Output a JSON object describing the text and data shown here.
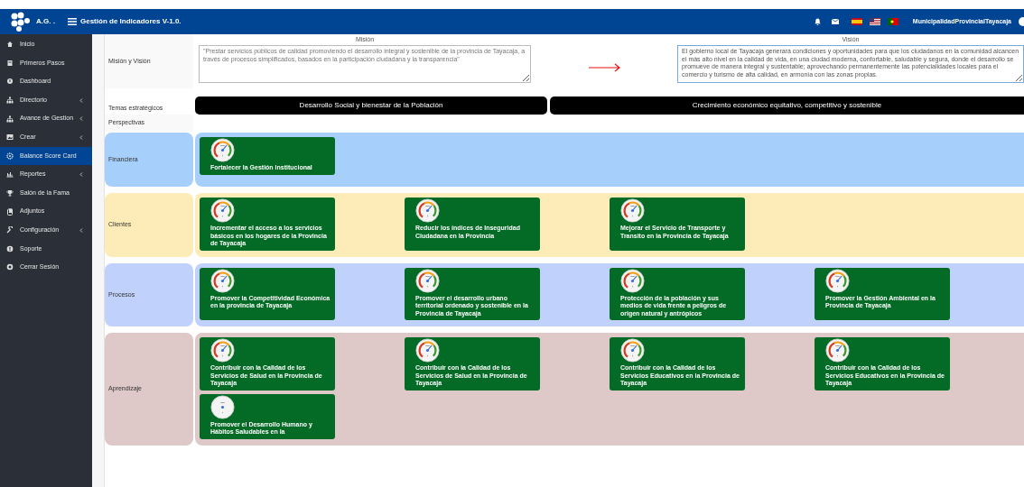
{
  "header": {
    "logo_text": "A.G. .",
    "title": "Gestión de Indicadores V-1.0.",
    "user": "MunicipalidadProvincialTayacaja"
  },
  "sidebar": {
    "items": [
      {
        "label": "Inicio",
        "has_submenu": false,
        "selected": false
      },
      {
        "label": "Primeros Pasos",
        "has_submenu": false,
        "selected": false
      },
      {
        "label": "Dashboard",
        "has_submenu": false,
        "selected": false
      },
      {
        "label": "Directorio",
        "has_submenu": true,
        "selected": false
      },
      {
        "label": "Avance de Gestion",
        "has_submenu": true,
        "selected": false
      },
      {
        "label": "Crear",
        "has_submenu": true,
        "selected": false
      },
      {
        "label": "Balance Score Card",
        "has_submenu": false,
        "selected": true
      },
      {
        "label": "Reportes",
        "has_submenu": true,
        "selected": false
      },
      {
        "label": "Salón de la Fama",
        "has_submenu": false,
        "selected": false
      },
      {
        "label": "Adjuntos",
        "has_submenu": false,
        "selected": false
      },
      {
        "label": "Configuración",
        "has_submenu": true,
        "selected": false
      },
      {
        "label": "Soporte",
        "has_submenu": false,
        "selected": false
      },
      {
        "label": "Cerrar Sesión",
        "has_submenu": false,
        "selected": false
      }
    ]
  },
  "mission_vision": {
    "label": "Misión y Visión",
    "mission": {
      "heading": "Misión",
      "value": "\"Prestar servicios públicos de calidad promoviendo el desarrollo integral y sostenible de la provincia de Tayacaja, a través de procesos simplificados, basados en la participación ciudadana y la transparencia\""
    },
    "vision": {
      "heading": "Visión",
      "value": "El gobierno local de Tayacaja generará condiciones y oportunidades para que los ciudadanos en la comunidad alcancen el más alto nivel en la calidad de vida, en una ciudad moderna, confortable, saludable y segura, donde el desarrollo se promueve de manera integral y sustentable; aprovechando permanentemente las potencialidades locales para el comercio y turismo de alta calidad, en armonía con las zonas propias."
    }
  },
  "themes": {
    "label": "Temas estratégicos",
    "items": [
      "Desarrollo Social y bienestar de la Población",
      "Crecimiento económico equitativo, competitivo y sostenible"
    ]
  },
  "perspectives": {
    "label": "Perspectivas",
    "rows": [
      {
        "name": "Financiera",
        "color": "#a6d0fb",
        "objectives": [
          {
            "text": "Fortalecer la Gestión Institucional",
            "gauge_filled": true
          }
        ]
      },
      {
        "name": "Clientes",
        "color": "#feecb8",
        "objectives": [
          {
            "text": "Incrementar el acceso a los servicios básicos en los hogares de la Provincia de Tayacaja",
            "gauge_filled": true
          },
          {
            "text": "Reducir los índices de Inseguridad Ciudadana en la Provincia",
            "gauge_filled": true
          },
          {
            "text": "Mejorar el Servicio de Transporte y Transito en la Provincia de Tayacaja",
            "gauge_filled": true
          }
        ]
      },
      {
        "name": "Procesos",
        "color": "#c0d2fb",
        "objectives": [
          {
            "text": "Promover la Competitividad Económica en la provincia de Tayacaja",
            "gauge_filled": true
          },
          {
            "text": "Promover el desarrollo urbano territorial ordenado y sostenible en la Provincia de Tayacaja",
            "gauge_filled": true
          },
          {
            "text": "Protección de la población y sus medios de vida frente a peligros de origen natural y antrópicos",
            "gauge_filled": true
          },
          {
            "text": "Promover la Gestión Ambiental en la Provincia de Tayacaja",
            "gauge_filled": true
          }
        ]
      },
      {
        "name": "Aprendizaje",
        "color": "#dec8c8",
        "objectives": [
          {
            "text": "Contribuir con la Calidad de los Servicios de Salud en la Provincia de Tayacaja",
            "gauge_filled": true
          },
          {
            "text": "Contribuir con la Calidad de los Servicios de Salud en la Provincia de Tayacaja",
            "gauge_filled": true
          },
          {
            "text": "Contribuir con la Calidad de los Servicios Educativos en la Provincia de Tayacaja",
            "gauge_filled": true
          },
          {
            "text": "Contribuir con la Calidad de los Servicios Educativos en la Provincia de Tayacaja",
            "gauge_filled": true
          },
          {
            "text": "Promover el Desarrollo Humano y Hábitos Saludables en la",
            "gauge_filled": false
          }
        ]
      }
    ]
  }
}
